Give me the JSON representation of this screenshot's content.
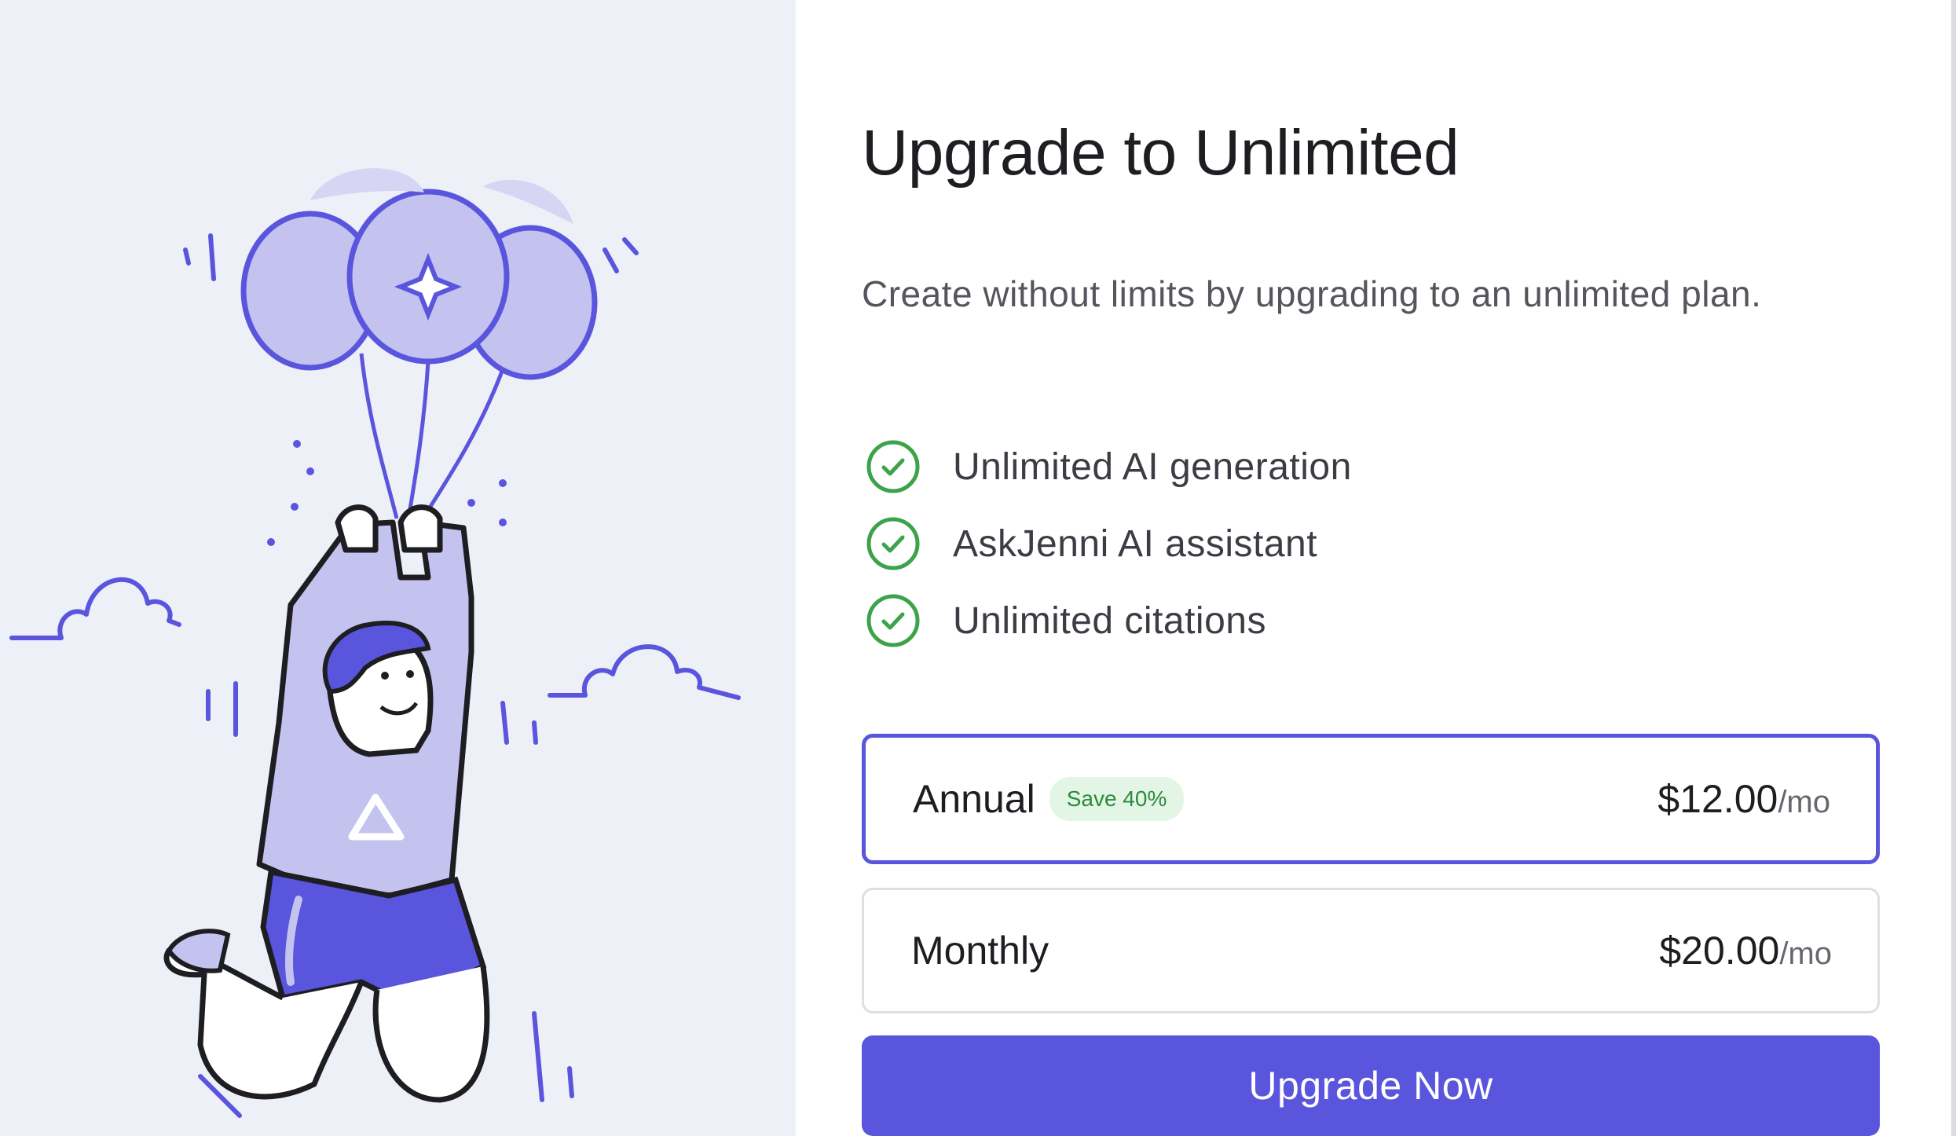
{
  "colors": {
    "accent": "#5a55dd",
    "illustration_bg": "#eef0f8",
    "balloon_fill": "#c4c3f0",
    "check_green": "#3da34b",
    "badge_bg": "#e3f6e6",
    "badge_text": "#2c8a3c"
  },
  "illustration": {
    "icon": "balloon-character-illustration"
  },
  "dialog": {
    "title": "Upgrade to Unlimited",
    "description": "Create without limits by upgrading to an unlimited plan.",
    "features": [
      {
        "icon": "check-circle-icon",
        "label": "Unlimited AI generation"
      },
      {
        "icon": "check-circle-icon",
        "label": "AskJenni AI assistant"
      },
      {
        "icon": "check-circle-icon",
        "label": "Unlimited citations"
      }
    ],
    "plans": [
      {
        "name": "Annual",
        "badge": "Save 40%",
        "price": "$12.00",
        "unit": "/mo",
        "selected": true
      },
      {
        "name": "Monthly",
        "badge": "",
        "price": "$20.00",
        "unit": "/mo",
        "selected": false
      }
    ],
    "cta_label": "Upgrade Now"
  }
}
